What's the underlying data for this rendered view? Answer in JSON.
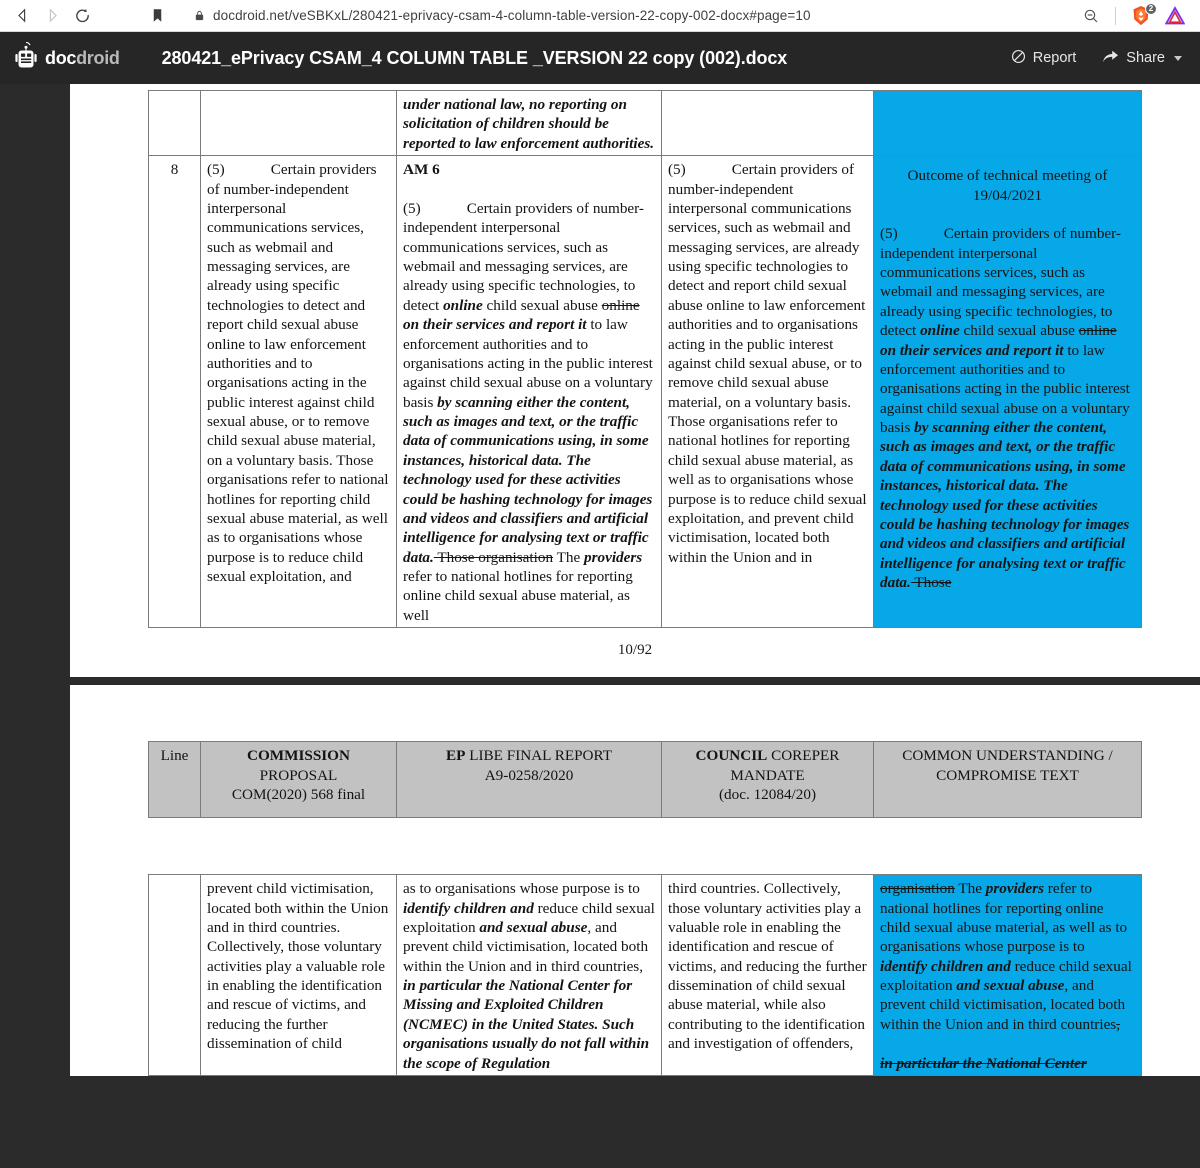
{
  "browser": {
    "back_icon": "back-arrow-icon",
    "forward_icon": "forward-arrow-icon",
    "reload_icon": "reload-icon",
    "bookmark_icon": "bookmark-icon",
    "lock_icon": "lock-icon",
    "url": "docdroid.net/veSBKxL/280421-eprivacy-csam-4-column-table-version-22-copy-002-docx#page=10",
    "zoom_out_icon": "zoom-out-icon",
    "brave_shield_icon": "brave-lion-shield-icon",
    "brave_badge_count": "2",
    "extension_icon": "purple-triangle-extension-icon"
  },
  "app": {
    "logo_icon": "docdroid-robot-icon",
    "logo_text_bold": "doc",
    "logo_text_light": "droid",
    "document_title": "280421_ePrivacy CSAM_4 COLUMN TABLE _VERSION 22 copy (002).docx",
    "report_label": "Report",
    "report_icon": "no-entry-icon",
    "share_label": "Share",
    "share_icon": "share-arrow-icon",
    "share_caret_icon": "chevron-down-icon"
  },
  "colors": {
    "highlight_blue": "#06a8e8",
    "header_gray": "#c2c2c2",
    "chrome_dark": "#262626",
    "viewer_background": "#2b2b2b"
  },
  "page1": {
    "page_number": "10/92",
    "row_partial": {
      "col_line": "",
      "col_commission": "",
      "col_ep_1": "under national law, no reporting on solicitation of children should be",
      "col_ep_2": "reported to law enforcement",
      "col_ep_3": "authorities.",
      "col_council": "",
      "col_common": ""
    },
    "row8": {
      "line": "8",
      "commission_num": "(5)",
      "commission": "Certain providers of number-independent interpersonal communications services, such as webmail and messaging services, are already using specific technologies to detect and report child sexual abuse online to law enforcement authorities and to  organisations acting in the public interest against child sexual abuse, or to remove child sexual abuse material, on a voluntary basis. Those organisations refer to national hotlines for reporting child sexual abuse material, as well as to organisations whose purpose is to reduce child sexual exploitation, and",
      "ep_amendment": "AM 6",
      "ep_num": "(5)",
      "ep_p1": "Certain providers of number-independent interpersonal communications services, such as webmail and messaging services, are already using specific technologies, to detect ",
      "ep_b1": "online",
      "ep_p2": " child sexual abuse ",
      "ep_s1": "online",
      "ep_b2": " on their services and report it",
      "ep_p3": " to law enforcement authorities and to organisations acting in the public interest against child sexual abuse on a voluntary basis ",
      "ep_b3": "by scanning either the content, such as images and text, or the traffic data of communications using, in some instances, historical data. The technology used for these activities could be hashing technology for images and videos and classifiers and artificial intelligence for analysing text or traffic data.",
      "ep_s2": " Those organisation",
      "ep_p4": " The ",
      "ep_b4": "providers",
      "ep_p5": " refer to national hotlines for reporting online child sexual abuse material, as well",
      "council_num": "(5)",
      "council": "Certain providers of number-independent interpersonal communications services, such as webmail and messaging services, are already using specific technologies to detect and report child sexual abuse online to law enforcement authorities and to organisations acting in the public interest against child sexual abuse, or to remove child sexual abuse material, on a voluntary basis. Those organisations refer to national hotlines for reporting child sexual abuse material, as well as to organisations whose purpose is to reduce child sexual exploitation, and prevent child victimisation, located both within the Union and in",
      "common_heading_1": "Outcome of technical meeting of",
      "common_heading_2": "19/04/2021",
      "common_num": "(5)",
      "common_p1": "Certain providers of number-independent interpersonal communications services, such as webmail and messaging services, are already using specific technologies, to detect ",
      "common_b1": "online",
      "common_p2": " child sexual abuse ",
      "common_s1": "online",
      "common_b2": " on their services and report it",
      "common_p3": " to law enforcement authorities and to organisations acting in the public interest against child sexual abuse on a voluntary basis ",
      "common_b3": "by scanning either the content, such as images and text, or the traffic data of communications using, in some instances, historical data. The technology used for these activities could be hashing technology for images and videos and classifiers and artificial intelligence for analysing text or traffic data.",
      "common_s2": " Those"
    }
  },
  "page2": {
    "headers": {
      "line": "Line",
      "commission_bold": "COMMISSION",
      "commission_rest": " PROPOSAL",
      "commission_sub": "COM(2020) 568 final",
      "ep_bold": "EP",
      "ep_rest": " LIBE FINAL REPORT",
      "ep_sub": "A9-0258/2020",
      "council_bold": "COUNCIL",
      "council_rest": " COREPER",
      "council_sub1": "MANDATE",
      "council_sub2": "(doc. 12084/20)",
      "common_l1": "COMMON UNDERSTANDING /",
      "common_l2": "COMPROMISE TEXT"
    },
    "row": {
      "line": "",
      "commission": "prevent child victimisation, located both within the Union and in third countries. Collectively, those voluntary activities play a valuable role in enabling the identification and rescue of victims, and reducing the further dissemination of child",
      "ep_p1": "as to organisations whose purpose is to ",
      "ep_b1": "identify children and",
      "ep_p2": " reduce child sexual exploitation ",
      "ep_b2": "and sexual abuse",
      "ep_p3": ", and prevent child victimisation, located both within the Union and in third countries, ",
      "ep_b3": "in particular the National Center for Missing and Exploited Children (NCMEC) in the United States. Such organisations usually do not fall within the scope of Regulation",
      "council": "third countries. Collectively, those voluntary activities play a valuable role in enabling the identification and rescue of victims, and reducing the further dissemination of child sexual abuse material, while also contributing to the identification and investigation of offenders,",
      "common_s1": "organisation",
      "common_p1": " The ",
      "common_b1": "providers",
      "common_p2": " refer to national hotlines for reporting online child sexual abuse material, as well as to organisations whose purpose is to ",
      "common_b2": "identify children and",
      "common_p3": " reduce child sexual exploitation ",
      "common_b3": "and sexual abuse",
      "common_p4": ", and prevent child victimisation, located both within the Union and in third countries",
      "common_s2": ",",
      "common_b4": "in particular the National Center"
    }
  }
}
